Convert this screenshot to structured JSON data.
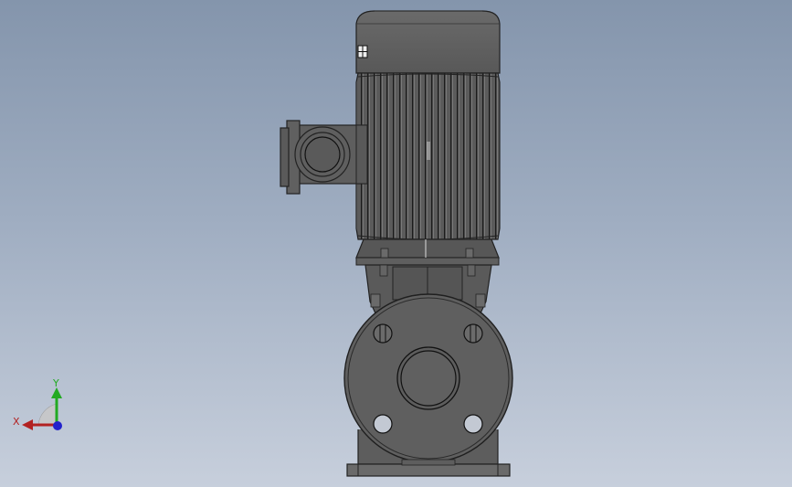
{
  "viewport": {
    "background_top": "#8495ac",
    "background_bottom": "#c7cfdc",
    "model": "vertical-inline-pump",
    "body_color": "#5f5f5f"
  },
  "triad": {
    "x_label": "X",
    "y_label": "Y",
    "x_color": "#b22222",
    "y_color": "#22aa22",
    "z_color": "#2222cc"
  }
}
